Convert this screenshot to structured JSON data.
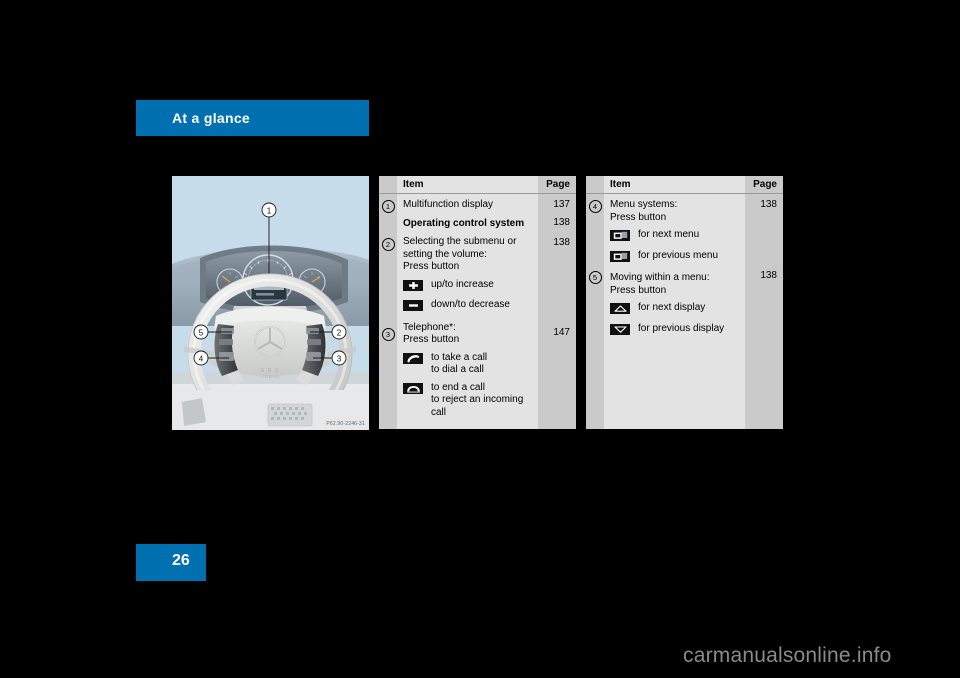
{
  "chapter": {
    "title": "At a glance"
  },
  "page": {
    "number": "26"
  },
  "figure": {
    "caption": "P62.90-2246-31",
    "callouts": [
      "1",
      "2",
      "3",
      "4",
      "5"
    ],
    "alt_label": "Steering wheel with multifunction display and control buttons"
  },
  "watermark": {
    "text": "carmanualsonline.info"
  },
  "tables": [
    {
      "id": "left",
      "headers": {
        "item": "Item",
        "page": "Page"
      },
      "rows": [
        {
          "num": "1",
          "text": "Multifunction display",
          "page": "137",
          "bold": false
        },
        {
          "num": "",
          "text": "Operating control system",
          "page": "138",
          "bold": true
        },
        {
          "num": "2",
          "text": "Selecting the submenu or\nsetting the volume:\nPress button",
          "page": "138",
          "bold": false
        },
        {
          "icon": "plus-icon",
          "label": "up/to increase"
        },
        {
          "icon": "minus-icon",
          "label": "down/to decrease"
        },
        {
          "num": "3",
          "text": "Telephone*:\nPress button",
          "page": "147",
          "bold": false
        },
        {
          "icon": "phone-offhook-icon",
          "label": "to take a call\nto dial a call"
        },
        {
          "icon": "phone-onhook-icon",
          "label": "to end a call\nto reject an incoming\ncall"
        }
      ]
    },
    {
      "id": "right",
      "headers": {
        "item": "Item",
        "page": "Page"
      },
      "rows": [
        {
          "num": "4",
          "text": "Menu systems:\nPress button",
          "page": "138",
          "bold": false
        },
        {
          "icon": "next-menu-icon",
          "label": "for next menu"
        },
        {
          "icon": "previous-menu-icon",
          "label": "for previous menu"
        },
        {
          "num": "5",
          "text": "Moving within a menu:\nPress button",
          "page": "138",
          "bold": false
        },
        {
          "icon": "arrow-up-icon",
          "label": "for next display"
        },
        {
          "icon": "arrow-down-icon",
          "label": "for previous display"
        }
      ]
    }
  ],
  "colors": {
    "accent": "#0070b0",
    "panel": "#e3e3e3",
    "gutter": "#cacaca",
    "sky": "#c6dcea"
  }
}
